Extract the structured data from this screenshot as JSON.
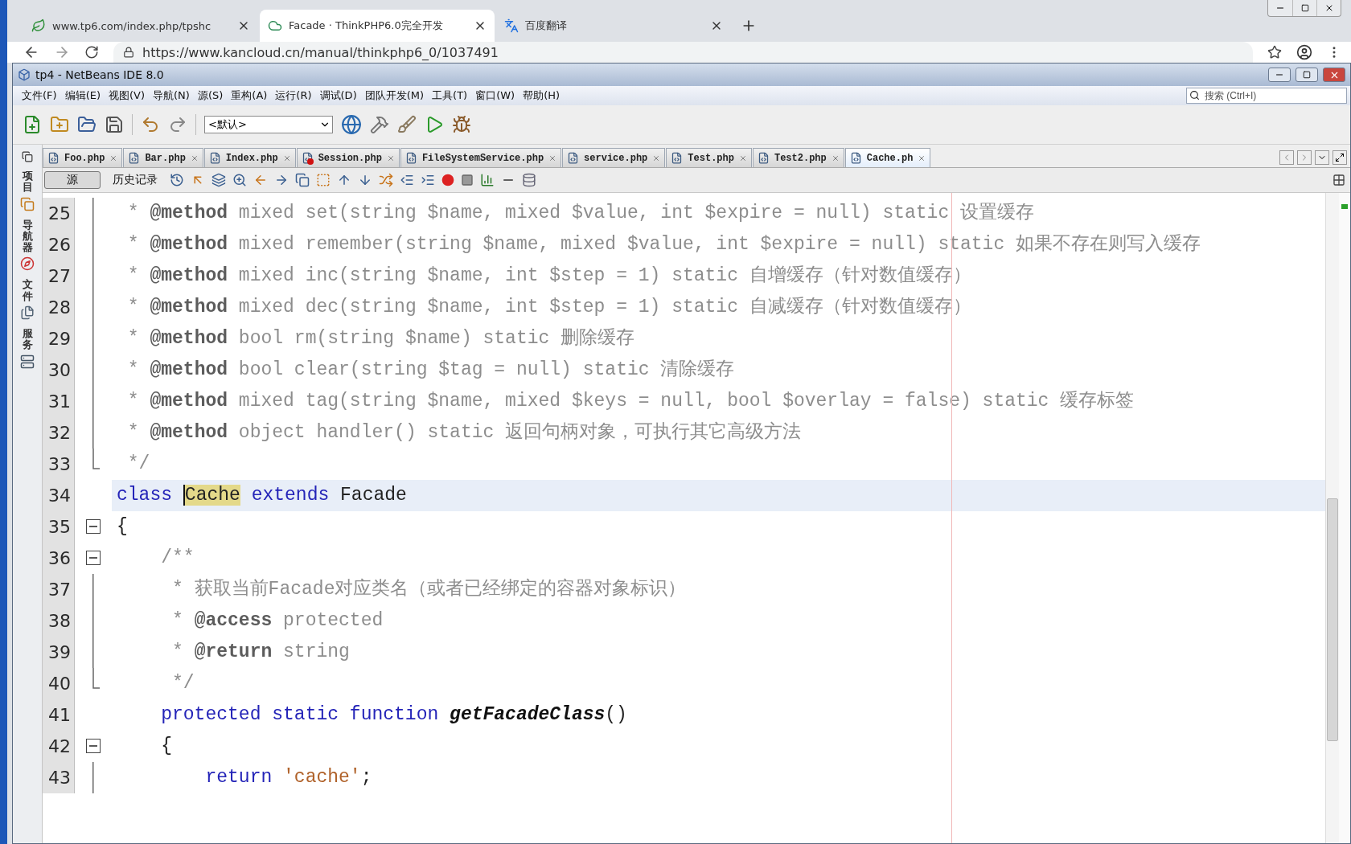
{
  "browser": {
    "tabs": [
      {
        "title": "www.tp6.com/index.php/tpshc",
        "selected": false
      },
      {
        "title": "Facade · ThinkPHP6.0完全开发",
        "selected": true
      },
      {
        "title": "百度翻译",
        "selected": false
      }
    ],
    "url": "https://www.kancloud.cn/manual/thinkphp6_0/1037491"
  },
  "ide": {
    "title": "tp4 - NetBeans IDE 8.0",
    "menu": [
      "文件(F)",
      "编辑(E)",
      "视图(V)",
      "导航(N)",
      "源(S)",
      "重构(A)",
      "运行(R)",
      "调试(D)",
      "团队开发(M)",
      "工具(T)",
      "窗口(W)",
      "帮助(H)"
    ],
    "search": {
      "placeholder": "搜索 (Ctrl+I)"
    },
    "configuration": "<默认>",
    "sidebar": [
      {
        "label": "项目"
      },
      {
        "label": "导航器"
      },
      {
        "label": "文件"
      },
      {
        "label": "服务"
      }
    ],
    "editor_tabs": [
      {
        "label": "Foo.php",
        "selected": false,
        "error": false
      },
      {
        "label": "Bar.php",
        "selected": false,
        "error": false
      },
      {
        "label": "Index.php",
        "selected": false,
        "error": false
      },
      {
        "label": "Session.php",
        "selected": false,
        "error": true
      },
      {
        "label": "FileSystemService.php",
        "selected": false,
        "error": false
      },
      {
        "label": "service.php",
        "selected": false,
        "error": false
      },
      {
        "label": "Test.php",
        "selected": false,
        "error": false
      },
      {
        "label": "Test2.php",
        "selected": false,
        "error": false
      },
      {
        "label": "Cache.ph",
        "selected": true,
        "error": false
      }
    ],
    "views": [
      {
        "label": "源",
        "selected": true
      },
      {
        "label": "历史记录",
        "selected": false
      }
    ],
    "lines": [
      {
        "number": "25",
        "kind": "line",
        "current": false,
        "segments": [
          {
            "kind": "comment",
            "text": " * "
          },
          {
            "kind": "doctag",
            "text": "@method"
          },
          {
            "kind": "comment",
            "text": " mixed set(string $name, mixed $value, int $expire = null) static 设置缓存"
          }
        ]
      },
      {
        "number": "26",
        "kind": "line",
        "current": false,
        "segments": [
          {
            "kind": "comment",
            "text": " * "
          },
          {
            "kind": "doctag",
            "text": "@method"
          },
          {
            "kind": "comment",
            "text": " mixed remember(string $name, mixed $value, int $expire = null) static 如果不存在则写入缓存"
          }
        ]
      },
      {
        "number": "27",
        "kind": "line",
        "current": false,
        "segments": [
          {
            "kind": "comment",
            "text": " * "
          },
          {
            "kind": "doctag",
            "text": "@method"
          },
          {
            "kind": "comment",
            "text": " mixed inc(string $name, int $step = 1) static 自增缓存（针对数值缓存）"
          }
        ]
      },
      {
        "number": "28",
        "kind": "line",
        "current": false,
        "segments": [
          {
            "kind": "comment",
            "text": " * "
          },
          {
            "kind": "doctag",
            "text": "@method"
          },
          {
            "kind": "comment",
            "text": " mixed dec(string $name, int $step = 1) static 自减缓存（针对数值缓存）"
          }
        ]
      },
      {
        "number": "29",
        "kind": "line",
        "current": false,
        "segments": [
          {
            "kind": "comment",
            "text": " * "
          },
          {
            "kind": "doctag",
            "text": "@method"
          },
          {
            "kind": "comment",
            "text": " bool rm(string $name) static 删除缓存"
          }
        ]
      },
      {
        "number": "30",
        "kind": "line",
        "current": false,
        "segments": [
          {
            "kind": "comment",
            "text": " * "
          },
          {
            "kind": "doctag",
            "text": "@method"
          },
          {
            "kind": "comment",
            "text": " bool clear(string $tag = null) static 清除缓存"
          }
        ]
      },
      {
        "number": "31",
        "kind": "line",
        "current": false,
        "segments": [
          {
            "kind": "comment",
            "text": " * "
          },
          {
            "kind": "doctag",
            "text": "@method"
          },
          {
            "kind": "comment",
            "text": " mixed tag(string $name, mixed $keys = null, bool $overlay = false) static 缓存标签"
          }
        ]
      },
      {
        "number": "32",
        "kind": "line",
        "current": false,
        "segments": [
          {
            "kind": "comment",
            "text": " * "
          },
          {
            "kind": "doctag",
            "text": "@method"
          },
          {
            "kind": "comment",
            "text": " object handler() static 返回句柄对象，可执行其它高级方法"
          }
        ]
      },
      {
        "number": "33",
        "kind": "end",
        "current": false,
        "segments": [
          {
            "kind": "comment",
            "text": " */"
          }
        ]
      },
      {
        "number": "34",
        "kind": "plain",
        "current": true,
        "segments": [
          {
            "kind": "keyword",
            "text": "class "
          },
          {
            "kind": "match",
            "text": "Cache"
          },
          {
            "kind": "keyword",
            "text": " extends"
          },
          {
            "kind": "plain",
            "text": " Facade"
          }
        ]
      },
      {
        "number": "35",
        "kind": "open",
        "current": false,
        "segments": [
          {
            "kind": "plain",
            "text": "{"
          }
        ]
      },
      {
        "number": "36",
        "kind": "open",
        "current": false,
        "segments": [
          {
            "kind": "comment",
            "text": "    /**"
          }
        ]
      },
      {
        "number": "37",
        "kind": "line",
        "current": false,
        "segments": [
          {
            "kind": "comment",
            "text": "     * 获取当前Facade对应类名（或者已经绑定的容器对象标识）"
          }
        ]
      },
      {
        "number": "38",
        "kind": "line",
        "current": false,
        "segments": [
          {
            "kind": "comment",
            "text": "     * "
          },
          {
            "kind": "doctag",
            "text": "@access"
          },
          {
            "kind": "comment",
            "text": " protected"
          }
        ]
      },
      {
        "number": "39",
        "kind": "line",
        "current": false,
        "segments": [
          {
            "kind": "comment",
            "text": "     * "
          },
          {
            "kind": "doctag",
            "text": "@return"
          },
          {
            "kind": "comment",
            "text": " string"
          }
        ]
      },
      {
        "number": "40",
        "kind": "end",
        "current": false,
        "segments": [
          {
            "kind": "comment",
            "text": "     */"
          }
        ]
      },
      {
        "number": "41",
        "kind": "plain",
        "current": false,
        "segments": [
          {
            "kind": "keyword",
            "text": "    protected static function "
          },
          {
            "kind": "method",
            "text": "getFacadeClass"
          },
          {
            "kind": "plain",
            "text": "()"
          }
        ]
      },
      {
        "number": "42",
        "kind": "open",
        "current": false,
        "segments": [
          {
            "kind": "plain",
            "text": "    {"
          }
        ]
      },
      {
        "number": "43",
        "kind": "line",
        "current": false,
        "segments": [
          {
            "kind": "keyword",
            "text": "        return "
          },
          {
            "kind": "string",
            "text": "'cache'"
          },
          {
            "kind": "plain",
            "text": ";"
          }
        ]
      }
    ]
  }
}
